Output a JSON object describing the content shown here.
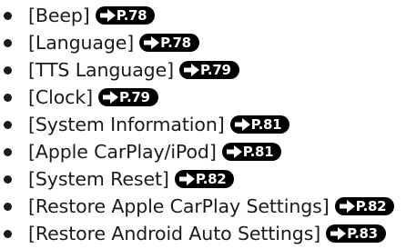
{
  "settings_list": {
    "items": [
      {
        "label": "[Beep]",
        "ref": "P.78"
      },
      {
        "label": "[Language]",
        "ref": "P.78"
      },
      {
        "label": "[TTS Language]",
        "ref": "P.79"
      },
      {
        "label": "[Clock]",
        "ref": "P.79"
      },
      {
        "label": "[System Information]",
        "ref": "P.81"
      },
      {
        "label": "[Apple CarPlay/iPod]",
        "ref": "P.81"
      },
      {
        "label": "[System Reset]",
        "ref": "P.82"
      },
      {
        "label": "[Restore Apple CarPlay Settings]",
        "ref": "P.82"
      },
      {
        "label": "[Restore Android Auto Settings]",
        "ref": "P.83"
      }
    ],
    "bullet_icon": "bullet-dot",
    "reference_icon": "page-reference-arrow-icon",
    "colors": {
      "text": "#1a1a1a",
      "badge_background": "#000000",
      "badge_text": "#ffffff"
    }
  }
}
